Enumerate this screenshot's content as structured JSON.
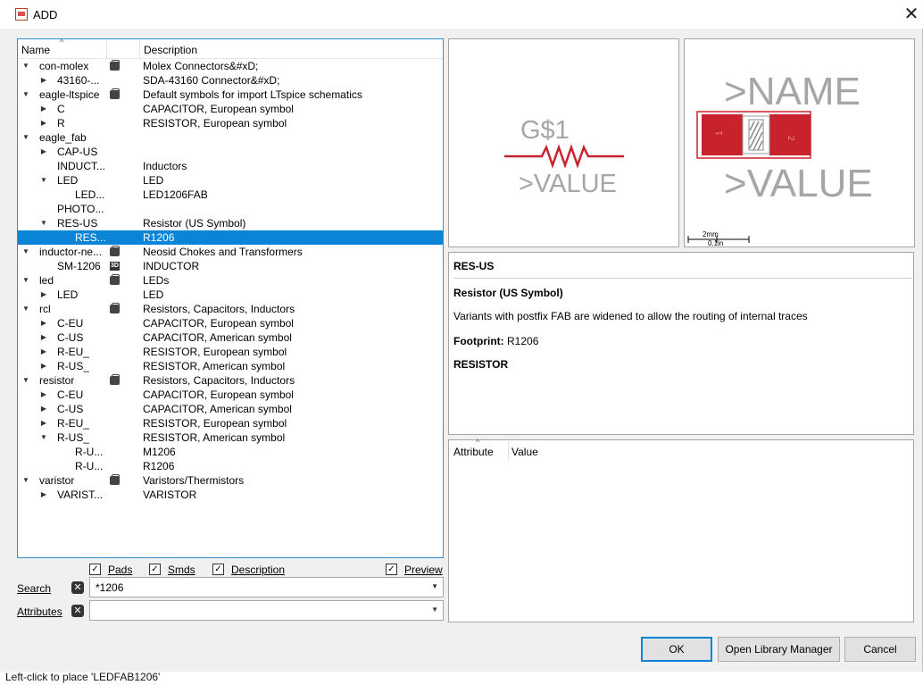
{
  "window": {
    "title": "ADD",
    "close": "✕"
  },
  "tree": {
    "col_name": "Name",
    "col_desc": "Description",
    "rows": [
      {
        "level": 0,
        "exp": "open",
        "name": "con-molex",
        "icon": "lib",
        "desc": "Molex Connectors&#xD;"
      },
      {
        "level": 1,
        "exp": "closed",
        "name": "43160-...",
        "icon": "",
        "desc": "SDA-43160 Connector&#xD;"
      },
      {
        "level": 0,
        "exp": "open",
        "name": "eagle-ltspice",
        "icon": "lib",
        "desc": "Default symbols for import LTspice schematics"
      },
      {
        "level": 1,
        "exp": "closed",
        "name": "C",
        "icon": "",
        "desc": "CAPACITOR, European symbol"
      },
      {
        "level": 1,
        "exp": "closed",
        "name": "R",
        "icon": "",
        "desc": "RESISTOR, European symbol"
      },
      {
        "level": 0,
        "exp": "open",
        "name": "eagle_fab",
        "icon": "",
        "desc": ""
      },
      {
        "level": 1,
        "exp": "closed",
        "name": "CAP-US",
        "icon": "",
        "desc": ""
      },
      {
        "level": 1,
        "exp": "none",
        "name": "INDUCT...",
        "icon": "",
        "desc": "Inductors"
      },
      {
        "level": 1,
        "exp": "open",
        "name": "LED",
        "icon": "",
        "desc": "LED"
      },
      {
        "level": 2,
        "exp": "none",
        "name": "LED...",
        "icon": "",
        "desc": "LED1206FAB"
      },
      {
        "level": 1,
        "exp": "none",
        "name": "PHOTO...",
        "icon": "",
        "desc": ""
      },
      {
        "level": 1,
        "exp": "open",
        "name": "RES-US",
        "icon": "",
        "desc": "Resistor (US Symbol)"
      },
      {
        "level": 2,
        "exp": "none",
        "name": "RES...",
        "icon": "",
        "desc": "R1206",
        "selected": true
      },
      {
        "level": 0,
        "exp": "open",
        "name": "inductor-ne...",
        "icon": "lib",
        "desc": "Neosid Chokes and Transformers"
      },
      {
        "level": 1,
        "exp": "none",
        "name": "SM-1206",
        "icon": "3d",
        "desc": "INDUCTOR"
      },
      {
        "level": 0,
        "exp": "open",
        "name": "led",
        "icon": "lib",
        "desc": "LEDs"
      },
      {
        "level": 1,
        "exp": "closed",
        "name": "LED",
        "icon": "",
        "desc": "LED"
      },
      {
        "level": 0,
        "exp": "open",
        "name": "rcl",
        "icon": "lib",
        "desc": "Resistors, Capacitors, Inductors"
      },
      {
        "level": 1,
        "exp": "closed",
        "name": "C-EU",
        "icon": "",
        "desc": "CAPACITOR, European symbol"
      },
      {
        "level": 1,
        "exp": "closed",
        "name": "C-US",
        "icon": "",
        "desc": "CAPACITOR, American symbol"
      },
      {
        "level": 1,
        "exp": "closed",
        "name": "R-EU_",
        "icon": "",
        "desc": "RESISTOR, European symbol"
      },
      {
        "level": 1,
        "exp": "closed",
        "name": "R-US_",
        "icon": "",
        "desc": "RESISTOR, American symbol"
      },
      {
        "level": 0,
        "exp": "open",
        "name": "resistor",
        "icon": "lib",
        "desc": "Resistors, Capacitors, Inductors"
      },
      {
        "level": 1,
        "exp": "closed",
        "name": "C-EU",
        "icon": "",
        "desc": "CAPACITOR, European symbol"
      },
      {
        "level": 1,
        "exp": "closed",
        "name": "C-US",
        "icon": "",
        "desc": "CAPACITOR, American symbol"
      },
      {
        "level": 1,
        "exp": "closed",
        "name": "R-EU_",
        "icon": "",
        "desc": "RESISTOR, European symbol"
      },
      {
        "level": 1,
        "exp": "open",
        "name": "R-US_",
        "icon": "",
        "desc": "RESISTOR, American symbol"
      },
      {
        "level": 2,
        "exp": "none",
        "name": "R-U...",
        "icon": "",
        "desc": "M1206"
      },
      {
        "level": 2,
        "exp": "none",
        "name": "R-U...",
        "icon": "",
        "desc": "R1206"
      },
      {
        "level": 0,
        "exp": "open",
        "name": "varistor",
        "icon": "lib",
        "desc": "Varistors/Thermistors"
      },
      {
        "level": 1,
        "exp": "closed",
        "name": "VARIST...",
        "icon": "",
        "desc": "VARISTOR"
      }
    ]
  },
  "filters": {
    "pads": {
      "label": "Pads",
      "checked": true
    },
    "smds": {
      "label": "Smds",
      "checked": true
    },
    "description": {
      "label": "Description",
      "checked": true
    },
    "preview": {
      "label": "Preview",
      "checked": true
    }
  },
  "search": {
    "label": "Search",
    "value": "*1206"
  },
  "attributes": {
    "label": "Attributes",
    "value": ""
  },
  "symbol_preview": {
    "name": "G$1",
    "value": ">VALUE",
    "wire_color": "#c8232c",
    "text_color": "#a6a6a6"
  },
  "footprint_preview": {
    "name": ">NAME",
    "value": ">VALUE",
    "pad1": "1",
    "pad2": "2",
    "scale_mm": "2mm",
    "scale_in": "0.1in",
    "pad_color": "#c8232c"
  },
  "info": {
    "device": "RES-US",
    "title": "Resistor (US Symbol)",
    "text": "Variants with postfix FAB are widened to allow the routing of internal traces",
    "footprint_label": "Footprint:",
    "footprint_value": "R1206",
    "symbol": "RESISTOR"
  },
  "attr_table": {
    "col_attr": "Attribute",
    "col_value": "Value"
  },
  "buttons": {
    "ok": "OK",
    "library_manager": "Open Library Manager",
    "cancel": "Cancel"
  },
  "status": "Left-click to place 'LEDFAB1206'"
}
